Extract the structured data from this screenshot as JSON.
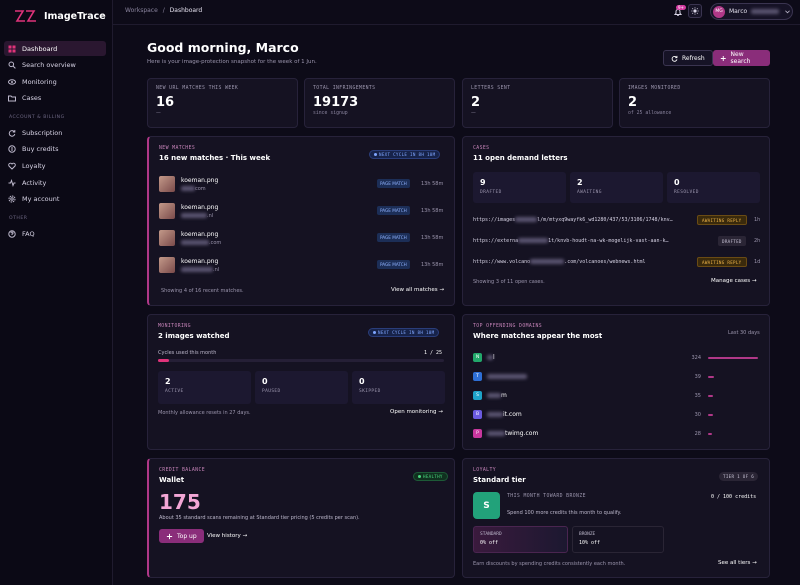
{
  "app": {
    "name": "ImageTrace",
    "brand_color": "#e0337a"
  },
  "sidebar": {
    "items": [
      {
        "label": "Dashboard",
        "icon": "grid-icon",
        "active": true
      },
      {
        "label": "Search overview",
        "icon": "search-icon"
      },
      {
        "label": "Monitoring",
        "icon": "eye-icon"
      },
      {
        "label": "Cases",
        "icon": "folder-icon"
      }
    ],
    "section_billing": "ACCOUNT & BILLING",
    "billing_items": [
      {
        "label": "Subscription",
        "icon": "refresh-icon"
      },
      {
        "label": "Buy credits",
        "icon": "coin-icon"
      },
      {
        "label": "Loyalty",
        "icon": "heart-icon"
      },
      {
        "label": "Activity",
        "icon": "activity-icon"
      },
      {
        "label": "My account",
        "icon": "gear-icon"
      }
    ],
    "section_other": "OTHER",
    "other_items": [
      {
        "label": "FAQ",
        "icon": "help-icon"
      }
    ]
  },
  "topbar": {
    "breadcrumb_root": "Workspace",
    "breadcrumb_sep": "/",
    "breadcrumb_current": "Dashboard",
    "notif_count": "9+",
    "user_initials": "MG",
    "user_name": "Marco"
  },
  "header": {
    "greeting": "Good morning, Marco",
    "subtitle": "Here is your image-protection snapshot for the week of 1 Jun.",
    "refresh_label": "Refresh",
    "new_search_label": "New search"
  },
  "stats": [
    {
      "label": "NEW URL MATCHES THIS WEEK",
      "value": "16",
      "sub": "—"
    },
    {
      "label": "TOTAL INFRINGEMENTS",
      "value": "19173",
      "sub": "since signup"
    },
    {
      "label": "LETTERS SENT",
      "value": "2",
      "sub": "—"
    },
    {
      "label": "IMAGES MONITORED",
      "value": "2",
      "sub": "of 25 allowance"
    }
  ],
  "new_matches": {
    "label": "NEW MATCHES",
    "title": "16 new matches · This week",
    "cycle_pill": "NEXT CYCLE IN 8H 10M",
    "rows": [
      {
        "file": "koeman.png",
        "domain": "com",
        "badge": "PAGE MATCH",
        "ago": "13h 58m"
      },
      {
        "file": "koeman.png",
        "domain": ".nl",
        "badge": "PAGE MATCH",
        "ago": "13h 58m"
      },
      {
        "file": "koeman.png",
        "domain": ".com",
        "badge": "PAGE MATCH",
        "ago": "13h 58m"
      },
      {
        "file": "koeman.png",
        "domain": ".nl",
        "badge": "PAGE MATCH",
        "ago": "13h 58m"
      }
    ],
    "footer": "Showing 4 of 16 recent matches.",
    "view_all": "View all matches →"
  },
  "cases": {
    "label": "CASES",
    "title": "11 open demand letters",
    "counts": [
      {
        "value": "9",
        "label": "DRAFTED"
      },
      {
        "value": "2",
        "label": "AWAITING"
      },
      {
        "value": "0",
        "label": "RESOLVED"
      }
    ],
    "rows": [
      {
        "url_a": "https://images",
        "url_b": "l/m/mtyxq9wayfk6_wd1280/437/53/3106/1748/knv…",
        "status": "AWAITING REPLY",
        "age": "1h"
      },
      {
        "url_a": "https://externa",
        "url_b": "1t/knvb-houdt-na-wk-mogelijk-vast-aan-k…",
        "status": "DRAFTED",
        "age": "2h"
      },
      {
        "url_a": "https://www.volcano",
        "url_b": ".com/volcanoes/webnews.html",
        "status": "AWAITING REPLY",
        "age": "1d"
      }
    ],
    "footer": "Showing 3 of 11 open cases.",
    "manage": "Manage cases →"
  },
  "monitoring": {
    "label": "MONITORING",
    "title": "2 images watched",
    "cycle_pill": "NEXT CYCLE IN 8H 10M",
    "cycles_label": "Cycles used this month",
    "cycles_value": "1 / 25",
    "cycles_progress": 0.04,
    "counts": [
      {
        "value": "2",
        "label": "ACTIVE"
      },
      {
        "value": "0",
        "label": "PAUSED"
      },
      {
        "value": "0",
        "label": "SKIPPED"
      }
    ],
    "footer": "Monthly allowance resets in 27 days.",
    "open": "Open monitoring →"
  },
  "domains": {
    "label": "TOP OFFENDING DOMAINS",
    "title": "Where matches appear the most",
    "range": "Last 30 days",
    "rows": [
      {
        "fav": "N",
        "color": "#22a86b",
        "name": "l",
        "count": 324
      },
      {
        "fav": "T",
        "color": "#2e6fd6",
        "name": "",
        "count": 39
      },
      {
        "fav": "S",
        "color": "#1ea3c9",
        "name": "m",
        "count": 35
      },
      {
        "fav": "B",
        "color": "#6a5ae0",
        "name": "it.com",
        "count": 30
      },
      {
        "fav": "P",
        "color": "#c8379e",
        "name": "twimg.com",
        "count": 28
      }
    ]
  },
  "wallet": {
    "label": "CREDIT BALANCE",
    "title": "Wallet",
    "status": "HEALTHY",
    "balance": "175",
    "note": "About 35 standard scans remaining at Standard tier pricing (5 credits per scan).",
    "topup": "Top up",
    "history": "View history →"
  },
  "loyalty": {
    "label": "LOYALTY",
    "title": "Standard tier",
    "tier_pill": "TIER 1 OF 6",
    "tier_letter": "S",
    "progress_label": "THIS MONTH TOWARD BRONZE",
    "progress_value": "0 / 100 credits",
    "progress_note": "Spend 100 more credits this month to qualify.",
    "tiers": [
      {
        "name": "STANDARD",
        "discount": "0% off"
      },
      {
        "name": "BRONZE",
        "discount": "10% off"
      }
    ],
    "footer": "Earn discounts by spending credits consistently each month.",
    "see_all": "See all tiers →"
  }
}
